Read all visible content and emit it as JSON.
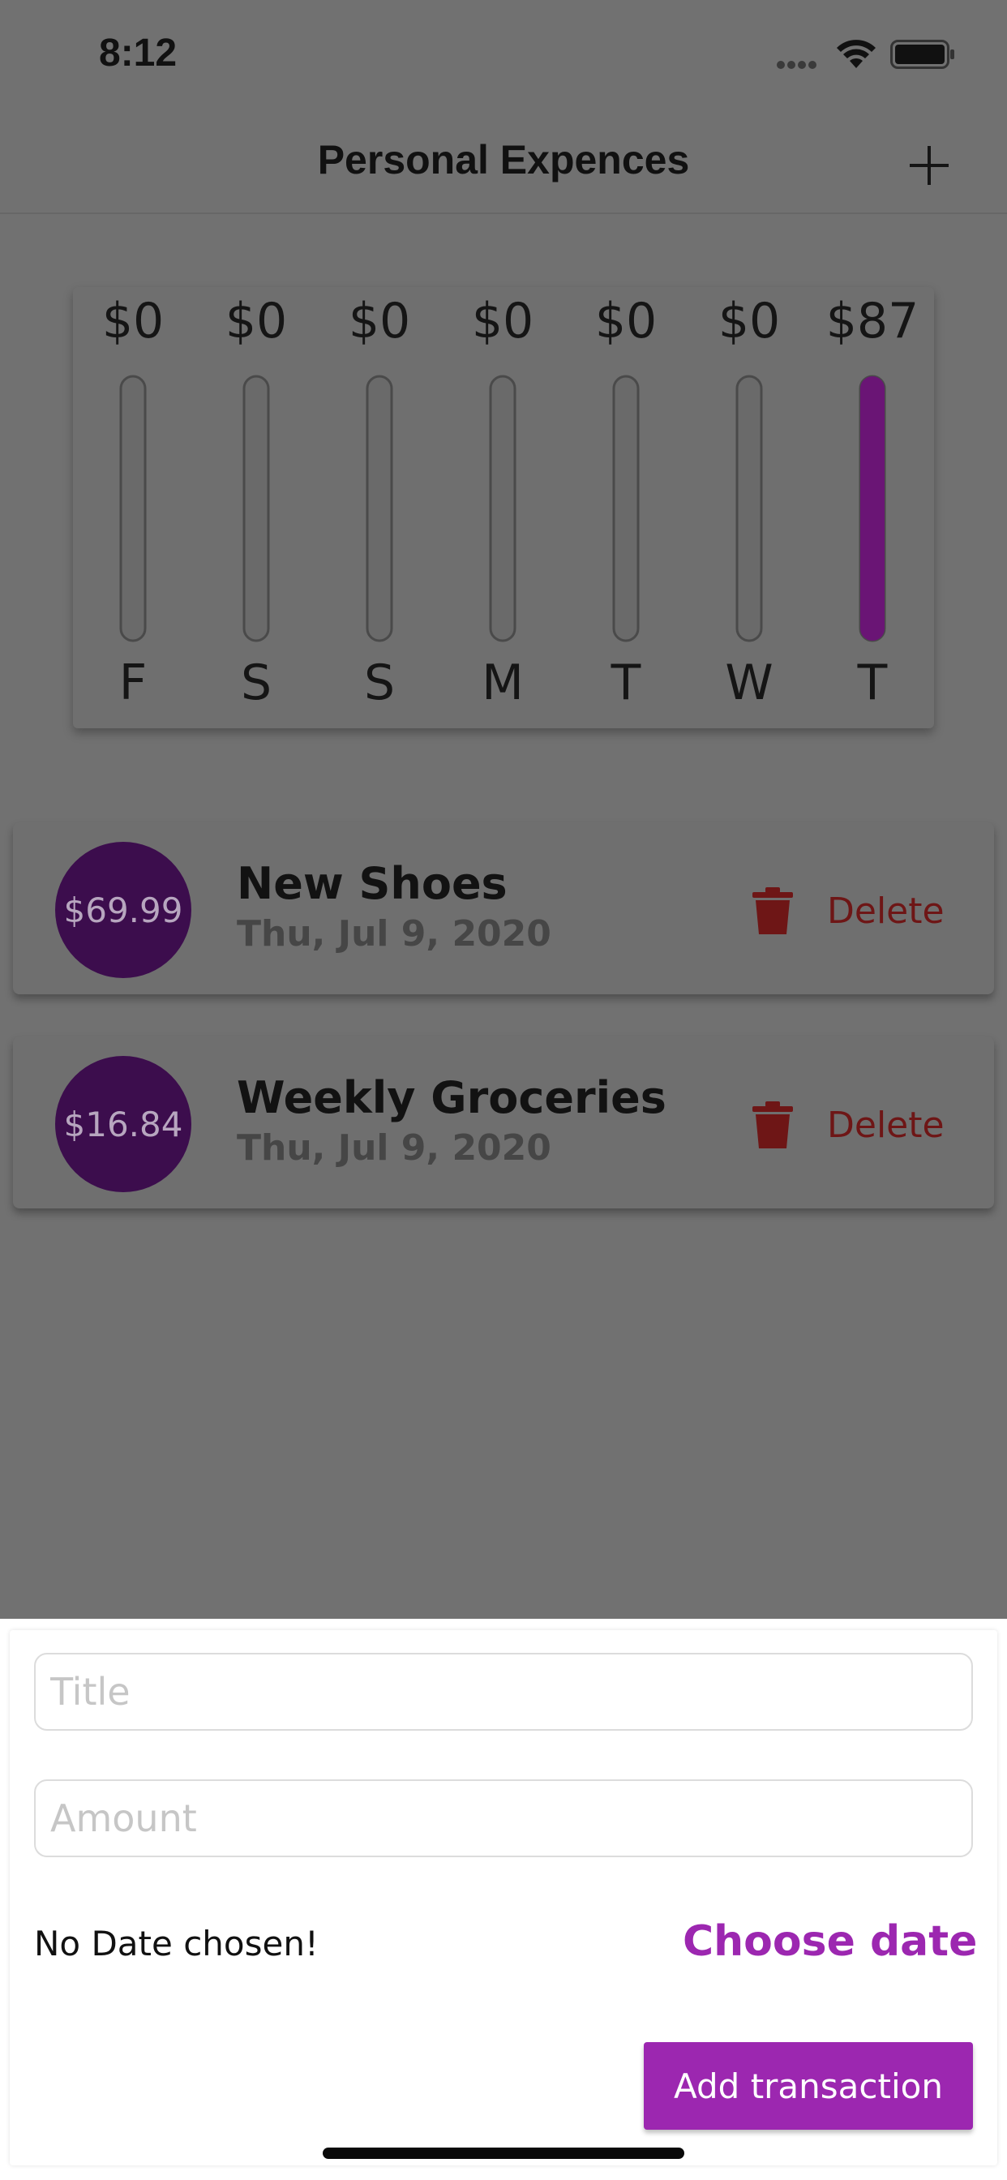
{
  "status_bar": {
    "time": "8:12"
  },
  "app_bar": {
    "title": "Personal Expences",
    "add_icon": "plus-icon"
  },
  "chart_data": {
    "type": "bar",
    "categories": [
      "F",
      "S",
      "S",
      "M",
      "T",
      "W",
      "T"
    ],
    "values": [
      0,
      0,
      0,
      0,
      0,
      0,
      87
    ],
    "value_labels": [
      "$0",
      "$0",
      "$0",
      "$0",
      "$0",
      "$0",
      "$87"
    ],
    "spending_fraction": [
      0,
      0,
      0,
      0,
      0,
      0,
      1
    ],
    "colors": {
      "fill": "#6a1575",
      "track": "#6a6a6a",
      "track_border": "#4a4a4a"
    }
  },
  "transactions": [
    {
      "amount": "$69.99",
      "title": "New Shoes",
      "date": "Thu, Jul 9, 2020",
      "delete_label": "Delete"
    },
    {
      "amount": "$16.84",
      "title": "Weekly Groceries",
      "date": "Thu, Jul 9, 2020",
      "delete_label": "Delete"
    }
  ],
  "form": {
    "title_placeholder": "Title",
    "amount_placeholder": "Amount",
    "no_date_text": "No Date chosen!",
    "choose_date_label": "Choose date",
    "submit_label": "Add transaction"
  },
  "colors": {
    "accent": "#9c27b0",
    "avatar": "#3c0d4d",
    "delete": "#6e1616",
    "overlay_bg": "#717171"
  }
}
